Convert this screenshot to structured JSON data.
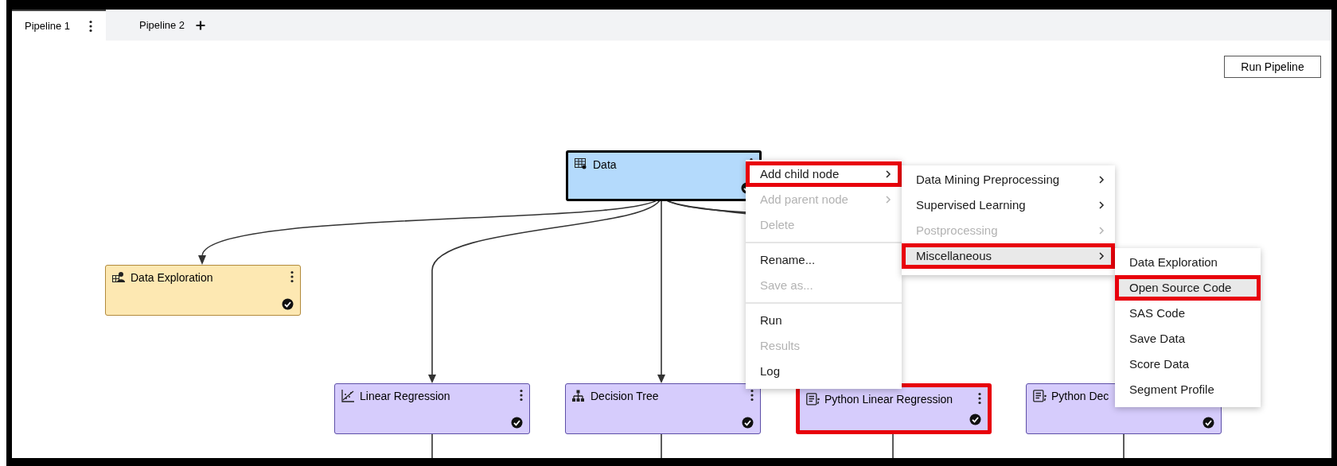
{
  "tabs": [
    {
      "label": "Pipeline 1",
      "selected": true
    },
    {
      "label": "Pipeline 2",
      "selected": false
    }
  ],
  "run_button": {
    "label": "Run Pipeline"
  },
  "nodes": [
    {
      "label": "Data",
      "kind": "data",
      "selected": true,
      "highlighted": false
    },
    {
      "label": "Data Exploration",
      "kind": "exploration",
      "selected": false,
      "highlighted": false
    },
    {
      "label": "Linear Regression",
      "kind": "regression",
      "selected": false,
      "highlighted": false
    },
    {
      "label": "Decision Tree",
      "kind": "tree",
      "selected": false,
      "highlighted": false
    },
    {
      "label": "Python Linear Regression",
      "kind": "python",
      "selected": false,
      "highlighted": true
    },
    {
      "label": "Python Dec",
      "kind": "python",
      "selected": false,
      "highlighted": false
    }
  ],
  "context_menu": {
    "items": [
      {
        "kind": "item",
        "label": "Add child node",
        "submenu": true,
        "disabled": false,
        "active": false,
        "highlighted": true
      },
      {
        "kind": "item",
        "label": "Add parent node",
        "submenu": true,
        "disabled": true,
        "active": false,
        "highlighted": false
      },
      {
        "kind": "item",
        "label": "Delete",
        "submenu": false,
        "disabled": true,
        "active": false,
        "highlighted": false
      },
      {
        "kind": "separator"
      },
      {
        "kind": "item",
        "label": "Rename...",
        "submenu": false,
        "disabled": false,
        "active": false,
        "highlighted": false
      },
      {
        "kind": "item",
        "label": "Save as...",
        "submenu": false,
        "disabled": true,
        "active": false,
        "highlighted": false
      },
      {
        "kind": "separator"
      },
      {
        "kind": "item",
        "label": "Run",
        "submenu": false,
        "disabled": false,
        "active": false,
        "highlighted": false
      },
      {
        "kind": "item",
        "label": "Results",
        "submenu": false,
        "disabled": true,
        "active": false,
        "highlighted": false
      },
      {
        "kind": "item",
        "label": "Log",
        "submenu": false,
        "disabled": false,
        "active": false,
        "highlighted": false
      }
    ]
  },
  "submenu": {
    "items": [
      {
        "kind": "item",
        "label": "Data Mining Preprocessing",
        "submenu": true,
        "disabled": false,
        "active": false,
        "highlighted": false
      },
      {
        "kind": "item",
        "label": "Supervised Learning",
        "submenu": true,
        "disabled": false,
        "active": false,
        "highlighted": false
      },
      {
        "kind": "item",
        "label": "Postprocessing",
        "submenu": true,
        "disabled": true,
        "active": false,
        "highlighted": false
      },
      {
        "kind": "item",
        "label": "Miscellaneous",
        "submenu": true,
        "disabled": false,
        "active": true,
        "highlighted": true
      }
    ]
  },
  "miscellaneous_menu": {
    "items": [
      {
        "kind": "item",
        "label": "Data Exploration",
        "submenu": false,
        "disabled": false,
        "active": false,
        "highlighted": false
      },
      {
        "kind": "item",
        "label": "Open Source Code",
        "submenu": false,
        "disabled": false,
        "active": true,
        "highlighted": true
      },
      {
        "kind": "item",
        "label": "SAS Code",
        "submenu": false,
        "disabled": false,
        "active": false,
        "highlighted": false
      },
      {
        "kind": "item",
        "label": "Save Data",
        "submenu": false,
        "disabled": false,
        "active": false,
        "highlighted": false
      },
      {
        "kind": "item",
        "label": "Score Data",
        "submenu": false,
        "disabled": false,
        "active": false,
        "highlighted": false
      },
      {
        "kind": "item",
        "label": "Segment Profile",
        "submenu": false,
        "disabled": false,
        "active": false,
        "highlighted": false
      }
    ]
  }
}
